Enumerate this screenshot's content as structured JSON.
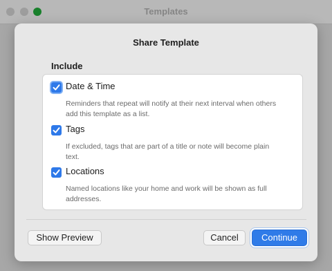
{
  "window": {
    "title": "Templates"
  },
  "sheet": {
    "title": "Share Template",
    "include_label": "Include",
    "options": [
      {
        "title": "Date & Time",
        "description": "Reminders that repeat will notify at their next interval when others add this template as a list.",
        "checked": true
      },
      {
        "title": "Tags",
        "description": "If excluded, tags that are part of a title or note will become plain text.",
        "checked": true
      },
      {
        "title": "Locations",
        "description": "Named locations like your home and work will be shown as full addresses.",
        "checked": true
      }
    ],
    "buttons": {
      "preview": "Show Preview",
      "cancel": "Cancel",
      "continue": "Continue"
    }
  },
  "colors": {
    "accent": "#2e79e9",
    "zoom_button": "#19802c"
  }
}
